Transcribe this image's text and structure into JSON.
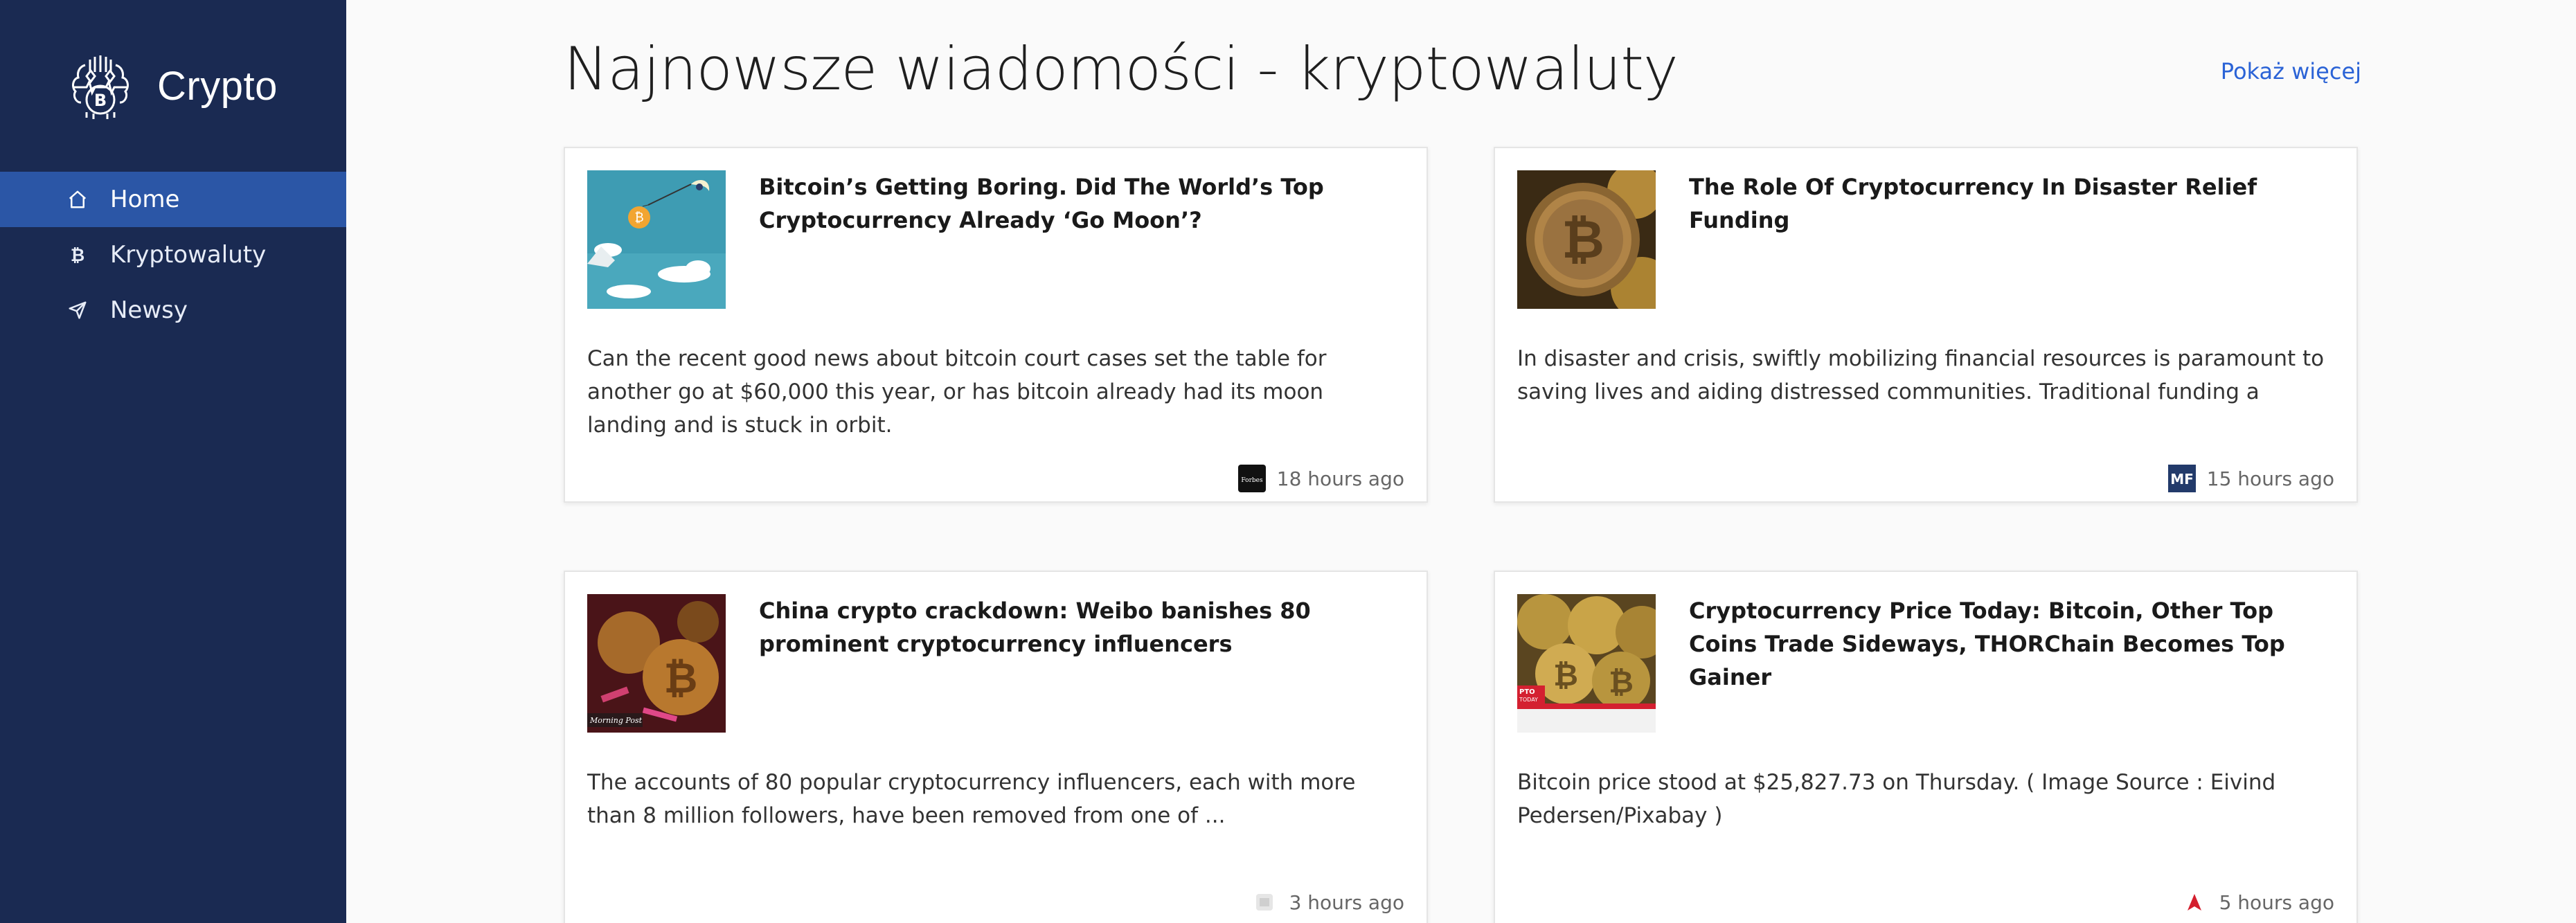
{
  "sidebar": {
    "brand": "Crypto",
    "items": [
      {
        "label": "Home",
        "icon": "home-icon",
        "active": true
      },
      {
        "label": "Kryptowaluty",
        "icon": "bitcoin-icon",
        "active": false
      },
      {
        "label": "Newsy",
        "icon": "send-icon",
        "active": false
      }
    ]
  },
  "main": {
    "title": "Najnowsze wiadomości - kryptowaluty",
    "show_more": "Pokaż więcej"
  },
  "news": [
    {
      "title": "Bitcoin’s Getting Boring. Did The World’s Top Cryptocurrency Already ‘Go Moon’?",
      "description": "Can the recent good news about bitcoin court cases set the table for another go at $60,000 this year, or has bitcoin already had its moon landing and is stuck in orbit.",
      "time": "18 hours ago",
      "source_icon": "forbes-logo-icon"
    },
    {
      "title": "The Role Of Cryptocurrency In Disaster Relief Funding",
      "description": "In disaster and crisis, swiftly mobilizing financial resources is paramount to saving lives and aiding distressed communities. Traditional funding a",
      "time": "15 hours ago",
      "source_icon": "mf-logo-icon"
    },
    {
      "title": "China crypto crackdown: Weibo banishes 80 prominent cryptocurrency influencers",
      "description": "The accounts of 80 popular cryptocurrency influencers, each with more than 8 million followers, have been removed from one of ...",
      "time": "3 hours ago",
      "source_icon": "generic-source-icon"
    },
    {
      "title": "Cryptocurrency Price Today: Bitcoin, Other Top Coins Trade Sideways, THORChain Becomes Top Gainer",
      "description": "Bitcoin price stood at $25,827.73 on Thursday. ( Image Source : Eivind Pedersen/Pixabay )",
      "time": "5 hours ago",
      "source_icon": "red-arrow-logo-icon"
    }
  ],
  "colors": {
    "sidebar_bg": "#1a2a52",
    "sidebar_active": "#2b56a6",
    "link": "#2b63d6",
    "page_bg": "#fafafa"
  }
}
